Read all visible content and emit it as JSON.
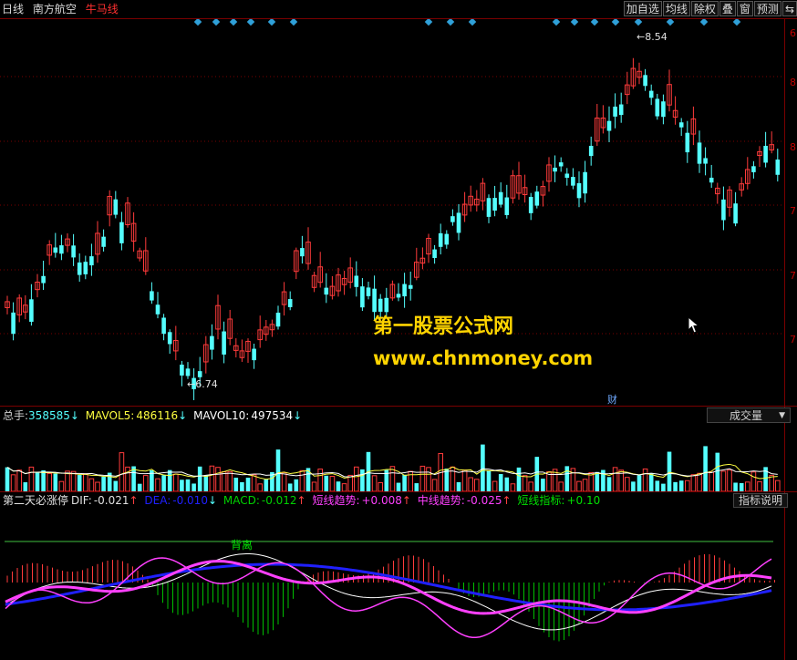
{
  "topbar": {
    "period": "日线",
    "stock_name": "南方航空",
    "indicator_name": "牛马线",
    "buttons": [
      "加自选",
      "均线",
      "除权",
      "叠",
      "窗",
      "预测"
    ],
    "arrows_glyph": "⇆"
  },
  "price_chart": {
    "high_label": "8.54",
    "low_label": "6.74",
    "cai_badge": "财",
    "right_axis_ticks": [
      "8",
      "8",
      "7",
      "7",
      "7",
      "6"
    ],
    "up_color": "#ff3b3b",
    "down_color": "#54ffff",
    "marker_color": "#2fa0d8"
  },
  "watermark": {
    "line1": "第一股票公式网",
    "line2": "www.chnmoney.com",
    "color": "#ffd400"
  },
  "volume_panel": {
    "label_total": "总手:",
    "total": "358585",
    "label_ma5": "MAVOL5:",
    "ma5": "486116",
    "label_ma10": "MAVOL10:",
    "ma10": "497534",
    "dropdown_value": "成交量"
  },
  "indicator_panel": {
    "name": "第二天必涨停",
    "dif_label": "DIF:",
    "dif": "-0.021",
    "dea_label": "DEA:",
    "dea": "-0.010",
    "macd_label": "MACD:",
    "macd": "-0.012",
    "short_trend_label": "短线趋势:",
    "short_trend": "+0.008",
    "mid_trend_label": "中线趋势:",
    "mid_trend": "-0.025",
    "short_ind_label": "短线指标:",
    "short_ind": "+0.10",
    "divergence_label": "背离",
    "explain_button": "指标说明"
  }
}
